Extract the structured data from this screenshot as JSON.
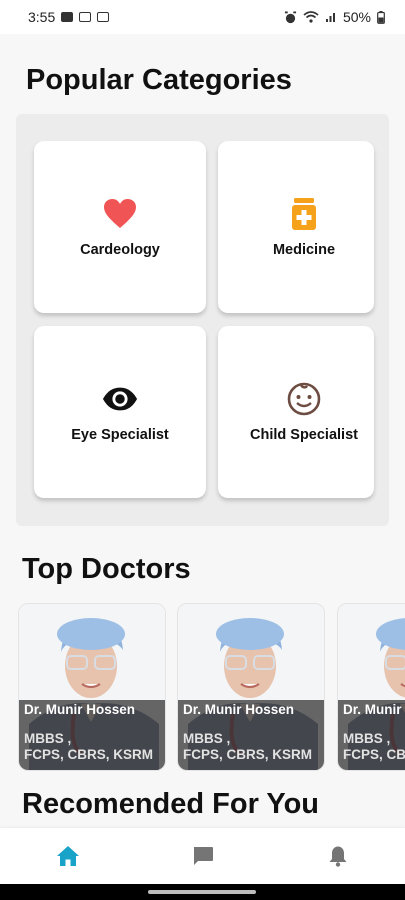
{
  "status_bar": {
    "time": "3:55",
    "battery": "50%",
    "left_icons": [
      "image-icon",
      "notification-icon",
      "notification-icon"
    ],
    "right_icons": [
      "alarm-icon",
      "wifi-icon",
      "signal-icon",
      "battery-icon"
    ]
  },
  "sections": {
    "popular_title": "Popular Categories",
    "top_doctors_title": "Top Doctors",
    "recommended_title": "Recomended For You"
  },
  "categories": [
    {
      "label": "Cardeology",
      "icon": "heart-icon",
      "color": "#f05454"
    },
    {
      "label": "Medicine",
      "icon": "medicine-bottle-icon",
      "color": "#f5a11a"
    },
    {
      "label": "Eye Specialist",
      "icon": "eye-icon",
      "color": "#111111"
    },
    {
      "label": "Child Specialist",
      "icon": "child-face-icon",
      "color": "#6d4c41"
    }
  ],
  "doctors": [
    {
      "name": "Dr. Munir Hossen",
      "degrees": "MBBS ,\nFCPS, CBRS, KSRM"
    },
    {
      "name": "Dr. Munir Hossen",
      "degrees": "MBBS ,\nFCPS, CBRS, KSRM"
    },
    {
      "name": "Dr. Munir Hossen",
      "degrees": "MBBS ,\nFCPS, CBRS, KSRM"
    }
  ],
  "bottom_nav": {
    "items": [
      {
        "icon": "home-icon",
        "active": true,
        "color": "#1aa3c9"
      },
      {
        "icon": "chat-icon",
        "active": false,
        "color": "#757575"
      },
      {
        "icon": "bell-icon",
        "active": false,
        "color": "#757575"
      }
    ]
  }
}
